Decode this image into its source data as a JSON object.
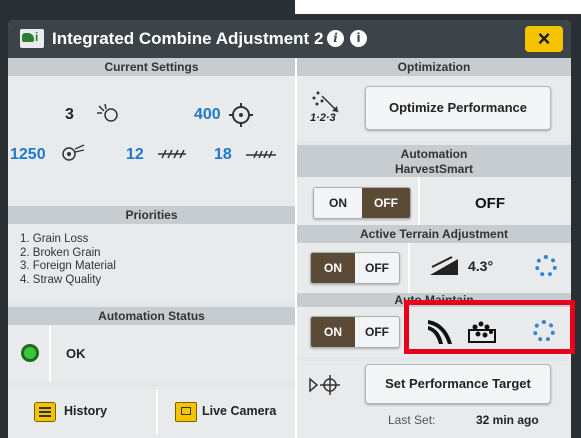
{
  "window": {
    "title": "Integrated Combine Adjustment 2",
    "close_label": "×"
  },
  "current_settings": {
    "header": "Current Settings",
    "row1": [
      {
        "value": "3",
        "icon": "rotor-speed-icon"
      },
      {
        "value": "400",
        "icon": "fan-speed-icon"
      }
    ],
    "row2": [
      {
        "value": "1250",
        "icon": "thresher-icon"
      },
      {
        "value": "12",
        "icon": "chaffer-icon"
      },
      {
        "value": "18",
        "icon": "sieve-icon"
      }
    ]
  },
  "priorities": {
    "header": "Priorities",
    "items": [
      "1. Grain Loss",
      "2. Broken Grain",
      "3. Foreign Material",
      "4. Straw Quality"
    ]
  },
  "automation_status": {
    "header": "Automation Status",
    "status_text": "OK"
  },
  "footer_left": {
    "history_label": "History",
    "camera_label": "Live Camera"
  },
  "optimization": {
    "header": "Optimization",
    "icon_label": "1·2·3",
    "button_label": "Optimize Performance"
  },
  "automation": {
    "header": "Automation",
    "harvestsmart": {
      "label": "HarvestSmart",
      "on": "ON",
      "off": "OFF",
      "state": "OFF"
    },
    "active_terrain": {
      "label": "Active Terrain Adjustment",
      "on": "ON",
      "off": "OFF",
      "angle": "4.3°"
    },
    "auto_maintain": {
      "label": "Auto Maintain",
      "on": "ON",
      "off": "OFF"
    }
  },
  "performance_target": {
    "button_label": "Set Performance Target",
    "last_set_label": "Last Set:",
    "last_set_value": "32 min ago"
  },
  "colors": {
    "title_bar": "#3c4449",
    "accent_yellow": "#f5c400",
    "value_blue": "#1f78c8",
    "highlight_red": "#e8001a",
    "status_green": "#3cc63c"
  }
}
